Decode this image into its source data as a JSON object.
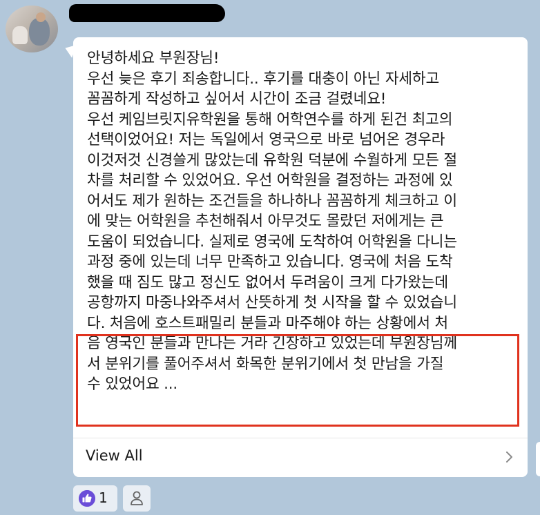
{
  "message": {
    "lines": [
      "안녕하세요 부원장님!",
      "우선 늦은 후기 죄송합니다..  후기를 대충이 아닌 자세하고",
      "꼼꼼하게 작성하고 싶어서 시간이 조금 걸렸네요!",
      "우선 케임브릿지유학원을 통해 어학연수를 하게 된건 최고의",
      "선택이었어요! 저는 독일에서 영국으로 바로 넘어온 경우라",
      "이것저것 신경쓸게 많았는데 유학원 덕분에 수월하게 모든 절",
      "차를 처리할 수 있었어요. 우선 어학원을 결정하는 과정에 있",
      "어서도 제가 원하는 조건들을 하나하나 꼼꼼하게 체크하고 이",
      "에 맞는 어학원을 추천해줘서 아무것도 몰랐던 저에게는 큰",
      "도움이 되었습니다. 실제로 영국에 도착하여 어학원을 다니는",
      "과정 중에 있는데 너무 만족하고 있습니다. 영국에 처음 도착",
      "했을 때 짐도 많고 정신도 없어서 두려움이 크게 다가왔는데",
      "공항까지 마중나와주셔서 산뜻하게 첫 시작을 할 수 있었습니",
      "다. 처음에 호스트패밀리 분들과 마주해야 하는 상황에서 처",
      "음 영국인 분들과 만나는 거라 긴장하고 있었는데 부원장님께",
      "서 분위기를 풀어주셔서 화목한 분위기에서 첫 만남을 가질",
      "수 있었어요 ..."
    ],
    "view_all_label": "View All"
  },
  "reactions": {
    "like_count": "1"
  },
  "colors": {
    "background": "#b2c7da",
    "bubble": "#ffffff",
    "highlight_border": "#e0321e",
    "like_accent": "#6a4dd8"
  },
  "icons": [
    "chevron-right-icon",
    "thumbs-up-icon",
    "person-icon"
  ]
}
